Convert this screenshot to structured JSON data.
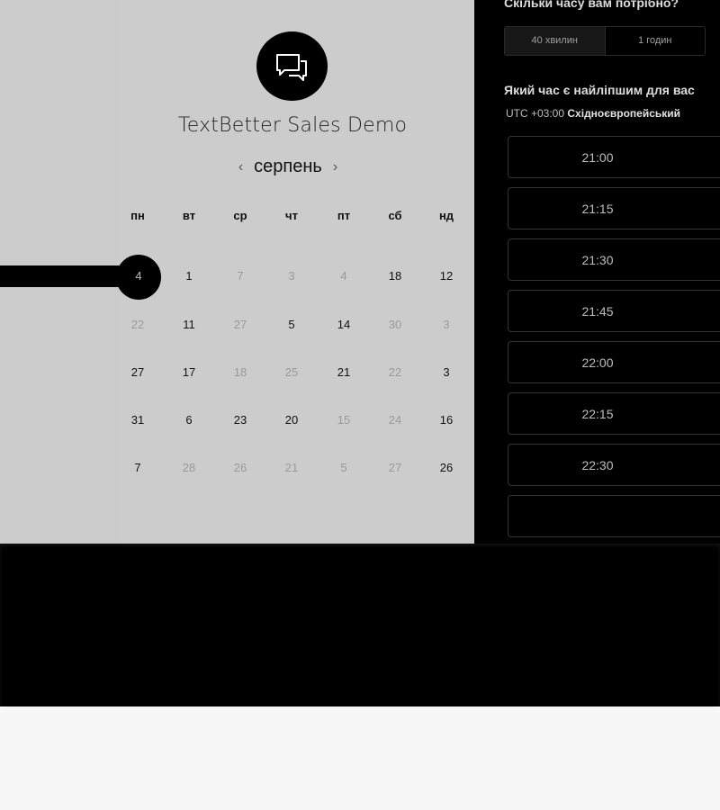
{
  "brand": {
    "title": "TextBetter Sales Demo"
  },
  "calendar": {
    "month": "серпень",
    "prev_icon": "‹",
    "next_icon": "›",
    "weekdays": [
      "пн",
      "вт",
      "ср",
      "чт",
      "пт",
      "сб",
      "нд"
    ],
    "weeks": [
      [
        {
          "d": "4",
          "on": true
        },
        {
          "d": "1",
          "on": true
        },
        {
          "d": "7",
          "on": false
        },
        {
          "d": "3",
          "on": false
        },
        {
          "d": "4",
          "on": false
        },
        {
          "d": "18",
          "on": true
        },
        {
          "d": "12",
          "on": true
        }
      ],
      [
        {
          "d": "22",
          "on": false
        },
        {
          "d": "11",
          "on": true
        },
        {
          "d": "27",
          "on": false
        },
        {
          "d": "5",
          "on": true
        },
        {
          "d": "14",
          "on": true
        },
        {
          "d": "30",
          "on": false
        },
        {
          "d": "3",
          "on": false
        }
      ],
      [
        {
          "d": "27",
          "on": true
        },
        {
          "d": "17",
          "on": true
        },
        {
          "d": "18",
          "on": false
        },
        {
          "d": "25",
          "on": false
        },
        {
          "d": "21",
          "on": true
        },
        {
          "d": "22",
          "on": false
        },
        {
          "d": "3",
          "on": true
        }
      ],
      [
        {
          "d": "31",
          "on": true
        },
        {
          "d": "6",
          "on": true
        },
        {
          "d": "23",
          "on": true
        },
        {
          "d": "20",
          "on": true
        },
        {
          "d": "15",
          "on": false
        },
        {
          "d": "24",
          "on": false
        },
        {
          "d": "16",
          "on": true
        }
      ],
      [
        {
          "d": "7",
          "on": true
        },
        {
          "d": "28",
          "on": false
        },
        {
          "d": "26",
          "on": false
        },
        {
          "d": "21",
          "on": false
        },
        {
          "d": "5",
          "on": false
        },
        {
          "d": "27",
          "on": false
        },
        {
          "d": "26",
          "on": true
        }
      ]
    ],
    "selected_day": "4"
  },
  "booking": {
    "duration_question": "Скільки часу вам потрібно?",
    "durations": [
      "40 хвилин",
      "1 годин"
    ],
    "time_question": "Який час є найліпшим для вас",
    "tz_offset": "UTC +03:00",
    "tz_name": "Східноєвропейський",
    "slots": [
      "21:00",
      "21:15",
      "21:30",
      "21:45",
      "22:00",
      "22:15",
      "22:30",
      ""
    ]
  },
  "colors": {
    "accent": "#000000",
    "panel": "#cbcbcb",
    "slot_border": "#333333"
  }
}
